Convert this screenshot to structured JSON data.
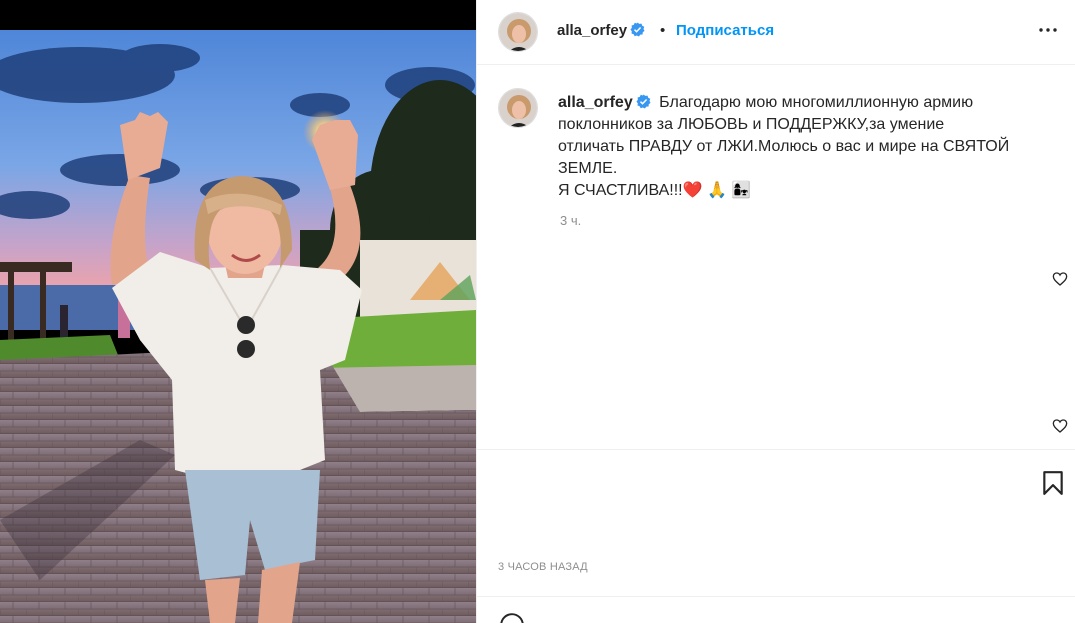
{
  "post": {
    "username": "alla_orfey",
    "separator": "•",
    "follow_label": "Подписаться",
    "more_icon": "more-horizontal-icon",
    "verified_icon": "verified-badge-icon",
    "caption_lines": [
      "Благодарю мою многомиллионную армию",
      "поклонников за ЛЮБОВЬ и ПОДДЕРЖКУ,за умение",
      "отличать ПРАВДУ от ЛЖИ.Молюсь о вас и мире на СВЯТОЙ",
      "ЗЕМЛЕ.",
      "Я СЧАСТЛИВА!!!❤️ 🙏 👩‍👧"
    ],
    "caption_age": "3 ч.",
    "timestamp": "3 часов назад",
    "icons": {
      "like": "heart-icon",
      "save": "bookmark-icon",
      "emoji": "emoji-icon"
    },
    "colors": {
      "follow": "#0095f6",
      "verified": "#3897f0",
      "text": "#262626",
      "muted": "#8e8e8e"
    }
  }
}
